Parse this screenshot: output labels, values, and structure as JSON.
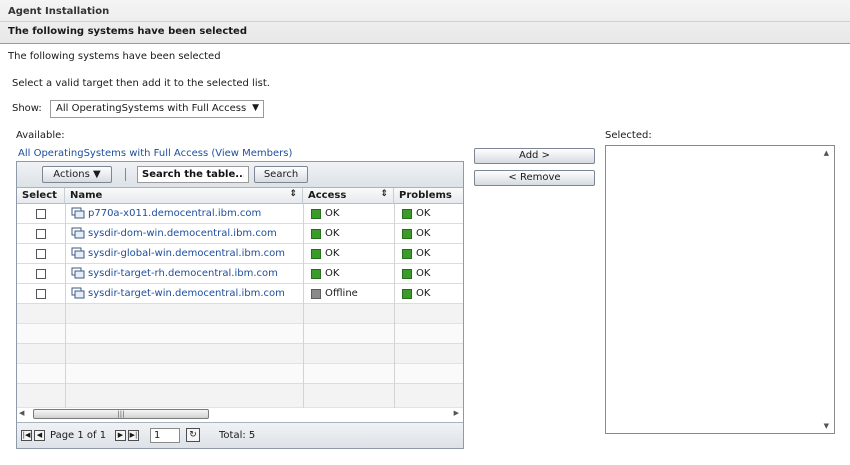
{
  "window": {
    "title": "Agent Installation",
    "subtitle": "The following systems have been selected"
  },
  "page": {
    "heading": "The following systems have been selected",
    "instruction": "Select a valid target then add it to the selected list."
  },
  "filter": {
    "show_label": "Show:",
    "value": "All OperatingSystems with Full Access"
  },
  "available": {
    "label": "Available:",
    "group_link": "All OperatingSystems with Full Access",
    "view_members": "(View Members)"
  },
  "toolbar": {
    "actions_label": "Actions",
    "search_value": "Search the table...",
    "search_button": "Search"
  },
  "table": {
    "headers": {
      "select": "Select",
      "name": "Name",
      "access": "Access",
      "problems": "Problems"
    },
    "rows": [
      {
        "name": "p770a-x011.democentral.ibm.com",
        "access": "OK",
        "problems": "OK"
      },
      {
        "name": "sysdir-dom-win.democentral.ibm.com",
        "access": "OK",
        "problems": "OK"
      },
      {
        "name": "sysdir-global-win.democentral.ibm.com",
        "access": "OK",
        "problems": "OK"
      },
      {
        "name": "sysdir-target-rh.democentral.ibm.com",
        "access": "OK",
        "problems": "OK"
      },
      {
        "name": "sysdir-target-win.democentral.ibm.com",
        "access": "Offline",
        "problems": "OK"
      }
    ]
  },
  "pager": {
    "page_text": "Page 1 of 1",
    "page_input": "1",
    "total": "Total: 5"
  },
  "buttons": {
    "add": "Add >",
    "remove": "< Remove"
  },
  "selected": {
    "label": "Selected:"
  },
  "colors": {
    "ok": "#3a9a2a",
    "offline": "#8a8a8a",
    "link": "#1d4e9c"
  }
}
